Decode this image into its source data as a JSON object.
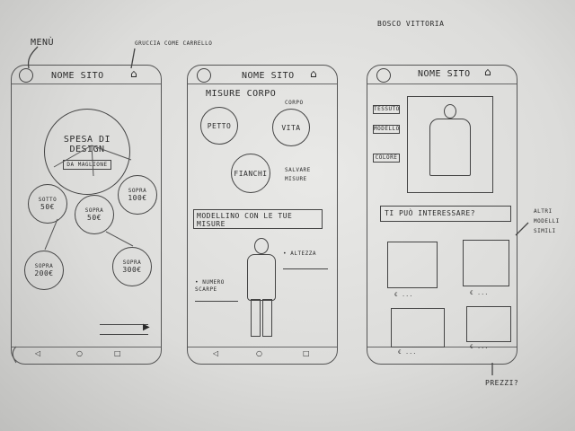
{
  "annotations": {
    "menu": "MENÙ",
    "cart_icon_note": "GRUCCIA COME CARRELLO",
    "top_right": "BOSCO VITTORIA",
    "other_models": "ALTRI MODELLI SIMILI",
    "prices_question": "PREZZI?"
  },
  "screen1": {
    "site_name": "NOME SITO",
    "main_circle_line1": "SPESA DI",
    "main_circle_line2": "DESIGN",
    "main_circle_sub": "DA MAGLIONE",
    "circles": [
      {
        "line1": "SOTTO",
        "line2": "50€"
      },
      {
        "line1": "SOPRA",
        "line2": "50€"
      },
      {
        "line1": "SOPRA",
        "line2": "100€"
      },
      {
        "line1": "SOPRA",
        "line2": "200€"
      },
      {
        "line1": "SOPRA",
        "line2": "300€"
      }
    ]
  },
  "screen2": {
    "site_name": "NOME SITO",
    "title": "MISURE CORPO",
    "title_alt": "CORPO",
    "circles": [
      "PETTO",
      "VITA",
      "FIANCHI"
    ],
    "save_note": "SALVARE MISURE",
    "model_text": "MODELLINO CON LE TUE MISURE",
    "height_label": "• ALTEZZA",
    "shoe_label": "• NUMERO SCARPE"
  },
  "screen3": {
    "site_name": "NOME SITO",
    "side_buttons": [
      "TESSUTO",
      "MODELLO",
      "COLORE"
    ],
    "question": "TI PUÒ INTERESSARE?",
    "prices": [
      "€ ...",
      "€ ...",
      "€ ...",
      "€ ..."
    ]
  },
  "colors": {
    "paper": "#e6e6e4",
    "pencil": "#2b2b2b"
  }
}
